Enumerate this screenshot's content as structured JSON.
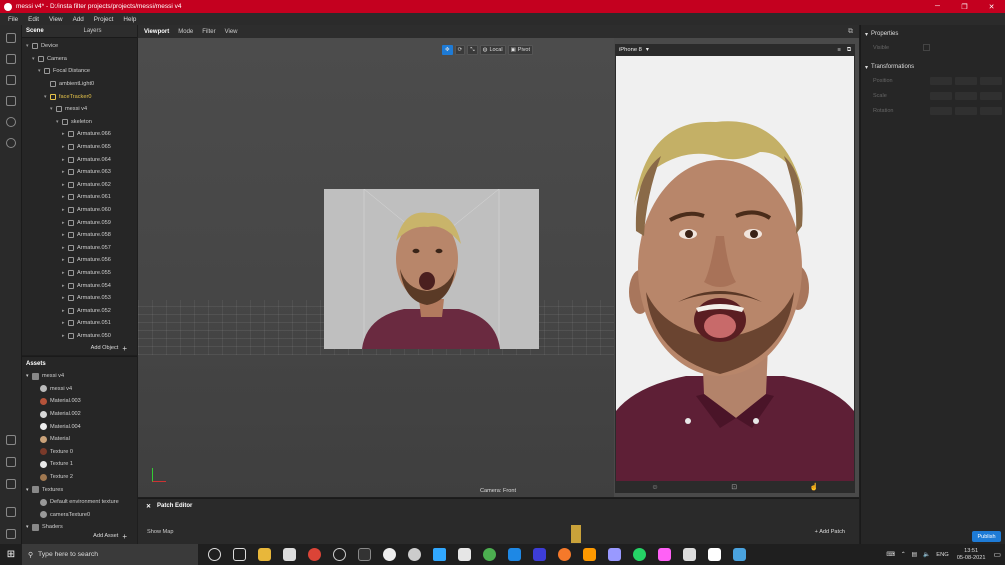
{
  "titlebar": {
    "title": "messi v4* - D:/insta filter projects/projects/messi/messi v4"
  },
  "menu": [
    "File",
    "Edit",
    "View",
    "Add",
    "Project",
    "Help"
  ],
  "scene": {
    "tabs": [
      "Scene",
      "Layers"
    ],
    "tree": [
      {
        "label": "Device",
        "depth": 0,
        "arrow": "▾"
      },
      {
        "label": "Camera",
        "depth": 1,
        "arrow": "▾"
      },
      {
        "label": "Focal Distance",
        "depth": 2,
        "arrow": "▾"
      },
      {
        "label": "ambientLight0",
        "depth": 3,
        "arrow": ""
      },
      {
        "label": "faceTracker0",
        "depth": 3,
        "arrow": "▾",
        "selected": true
      },
      {
        "label": "messi v4",
        "depth": 4,
        "arrow": "▾"
      },
      {
        "label": "skeleton",
        "depth": 5,
        "arrow": "▾"
      },
      {
        "label": "Armature.066",
        "depth": 6,
        "arrow": "▸"
      },
      {
        "label": "Armature.065",
        "depth": 6,
        "arrow": "▸"
      },
      {
        "label": "Armature.064",
        "depth": 6,
        "arrow": "▸"
      },
      {
        "label": "Armature.063",
        "depth": 6,
        "arrow": "▸"
      },
      {
        "label": "Armature.062",
        "depth": 6,
        "arrow": "▸"
      },
      {
        "label": "Armature.061",
        "depth": 6,
        "arrow": "▸"
      },
      {
        "label": "Armature.060",
        "depth": 6,
        "arrow": "▸"
      },
      {
        "label": "Armature.059",
        "depth": 6,
        "arrow": "▸"
      },
      {
        "label": "Armature.058",
        "depth": 6,
        "arrow": "▸"
      },
      {
        "label": "Armature.057",
        "depth": 6,
        "arrow": "▸"
      },
      {
        "label": "Armature.056",
        "depth": 6,
        "arrow": "▸"
      },
      {
        "label": "Armature.055",
        "depth": 6,
        "arrow": "▸"
      },
      {
        "label": "Armature.054",
        "depth": 6,
        "arrow": "▸"
      },
      {
        "label": "Armature.053",
        "depth": 6,
        "arrow": "▸"
      },
      {
        "label": "Armature.052",
        "depth": 6,
        "arrow": "▸"
      },
      {
        "label": "Armature.051",
        "depth": 6,
        "arrow": "▸"
      },
      {
        "label": "Armature.050",
        "depth": 6,
        "arrow": "▸"
      }
    ],
    "add_object": "Add Object"
  },
  "assets": {
    "title": "Assets",
    "items": [
      {
        "label": "messi v4",
        "depth": 0,
        "arrow": "▾",
        "color": "#888888"
      },
      {
        "label": "messi v4",
        "depth": 1,
        "arrow": "",
        "color": "#bbbbbb"
      },
      {
        "label": "Material.003",
        "depth": 1,
        "arrow": "",
        "color": "#b5533a"
      },
      {
        "label": "Material.002",
        "depth": 1,
        "arrow": "",
        "color": "#d8d8d8"
      },
      {
        "label": "Material.004",
        "depth": 1,
        "arrow": "",
        "color": "#eeeeee"
      },
      {
        "label": "Material",
        "depth": 1,
        "arrow": "",
        "color": "#c9a27a"
      },
      {
        "label": "Texture 0",
        "depth": 1,
        "arrow": "",
        "color": "#7a3a2a"
      },
      {
        "label": "Texture 1",
        "depth": 1,
        "arrow": "",
        "color": "#e8e8e8"
      },
      {
        "label": "Texture 2",
        "depth": 1,
        "arrow": "",
        "color": "#a07850"
      },
      {
        "label": "Textures",
        "depth": 0,
        "arrow": "▾",
        "color": "#888888"
      },
      {
        "label": "Default environment texture",
        "depth": 1,
        "arrow": "",
        "color": "#999999"
      },
      {
        "label": "cameraTexture0",
        "depth": 1,
        "arrow": "",
        "color": "#999999"
      },
      {
        "label": "Shaders",
        "depth": 0,
        "arrow": "▾",
        "color": "#888888"
      }
    ],
    "add_asset": "Add Asset"
  },
  "viewport": {
    "tabs": [
      "Viewport",
      "Mode",
      "Filter",
      "View"
    ],
    "toolbar": {
      "local": "Local",
      "pivot": "Pivot"
    },
    "camera_label": "Camera: Front"
  },
  "preview": {
    "device": "iPhone 8"
  },
  "properties": {
    "title": "Properties",
    "visible": "Visible",
    "transformations": "Transformations",
    "position": "Position",
    "scale": "Scale",
    "rotation": "Rotation",
    "publish": "Publish"
  },
  "patch_editor": {
    "title": "Patch Editor",
    "show_map": "Show Map",
    "add_patch": "Add Patch"
  },
  "taskbar": {
    "search_placeholder": "Type here to search",
    "language": "ENG",
    "time": "13:51",
    "date": "05-08-2021"
  },
  "colors": {
    "titlebar": "#c4001f",
    "accent": "#1e7bd6",
    "selection": "#e6c34a"
  }
}
